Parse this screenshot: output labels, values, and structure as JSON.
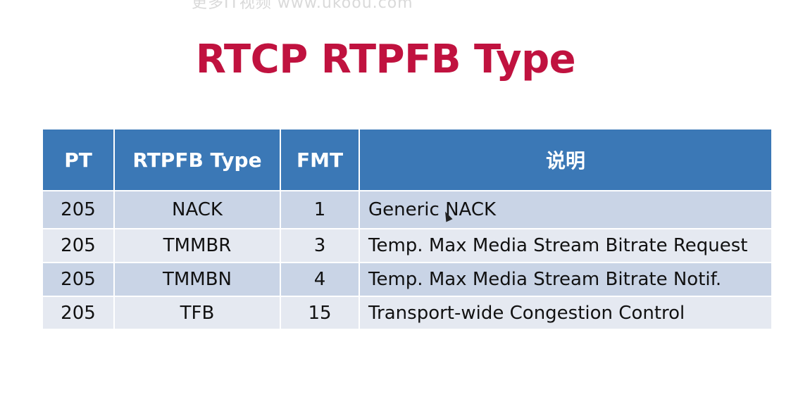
{
  "watermark": "更多IT视频 www.ukoou.com",
  "title": "RTCP RTPFB Type",
  "table": {
    "headers": [
      "PT",
      "RTPFB Type",
      "FMT",
      "说明"
    ],
    "rows": [
      [
        "205",
        "NACK",
        "1",
        "Generic NACK"
      ],
      [
        "205",
        "TMMBR",
        "3",
        "Temp. Max Media Stream Bitrate Request"
      ],
      [
        "205",
        "TMMBN",
        "4",
        "Temp. Max Media Stream Bitrate Notif."
      ],
      [
        "205",
        "TFB",
        "15",
        "Transport-wide Congestion Control"
      ]
    ]
  },
  "colors": {
    "title": "#c0123f",
    "header_bg": "#3b78b6",
    "row_dark": "#c9d4e6",
    "row_light": "#e5e9f1"
  }
}
